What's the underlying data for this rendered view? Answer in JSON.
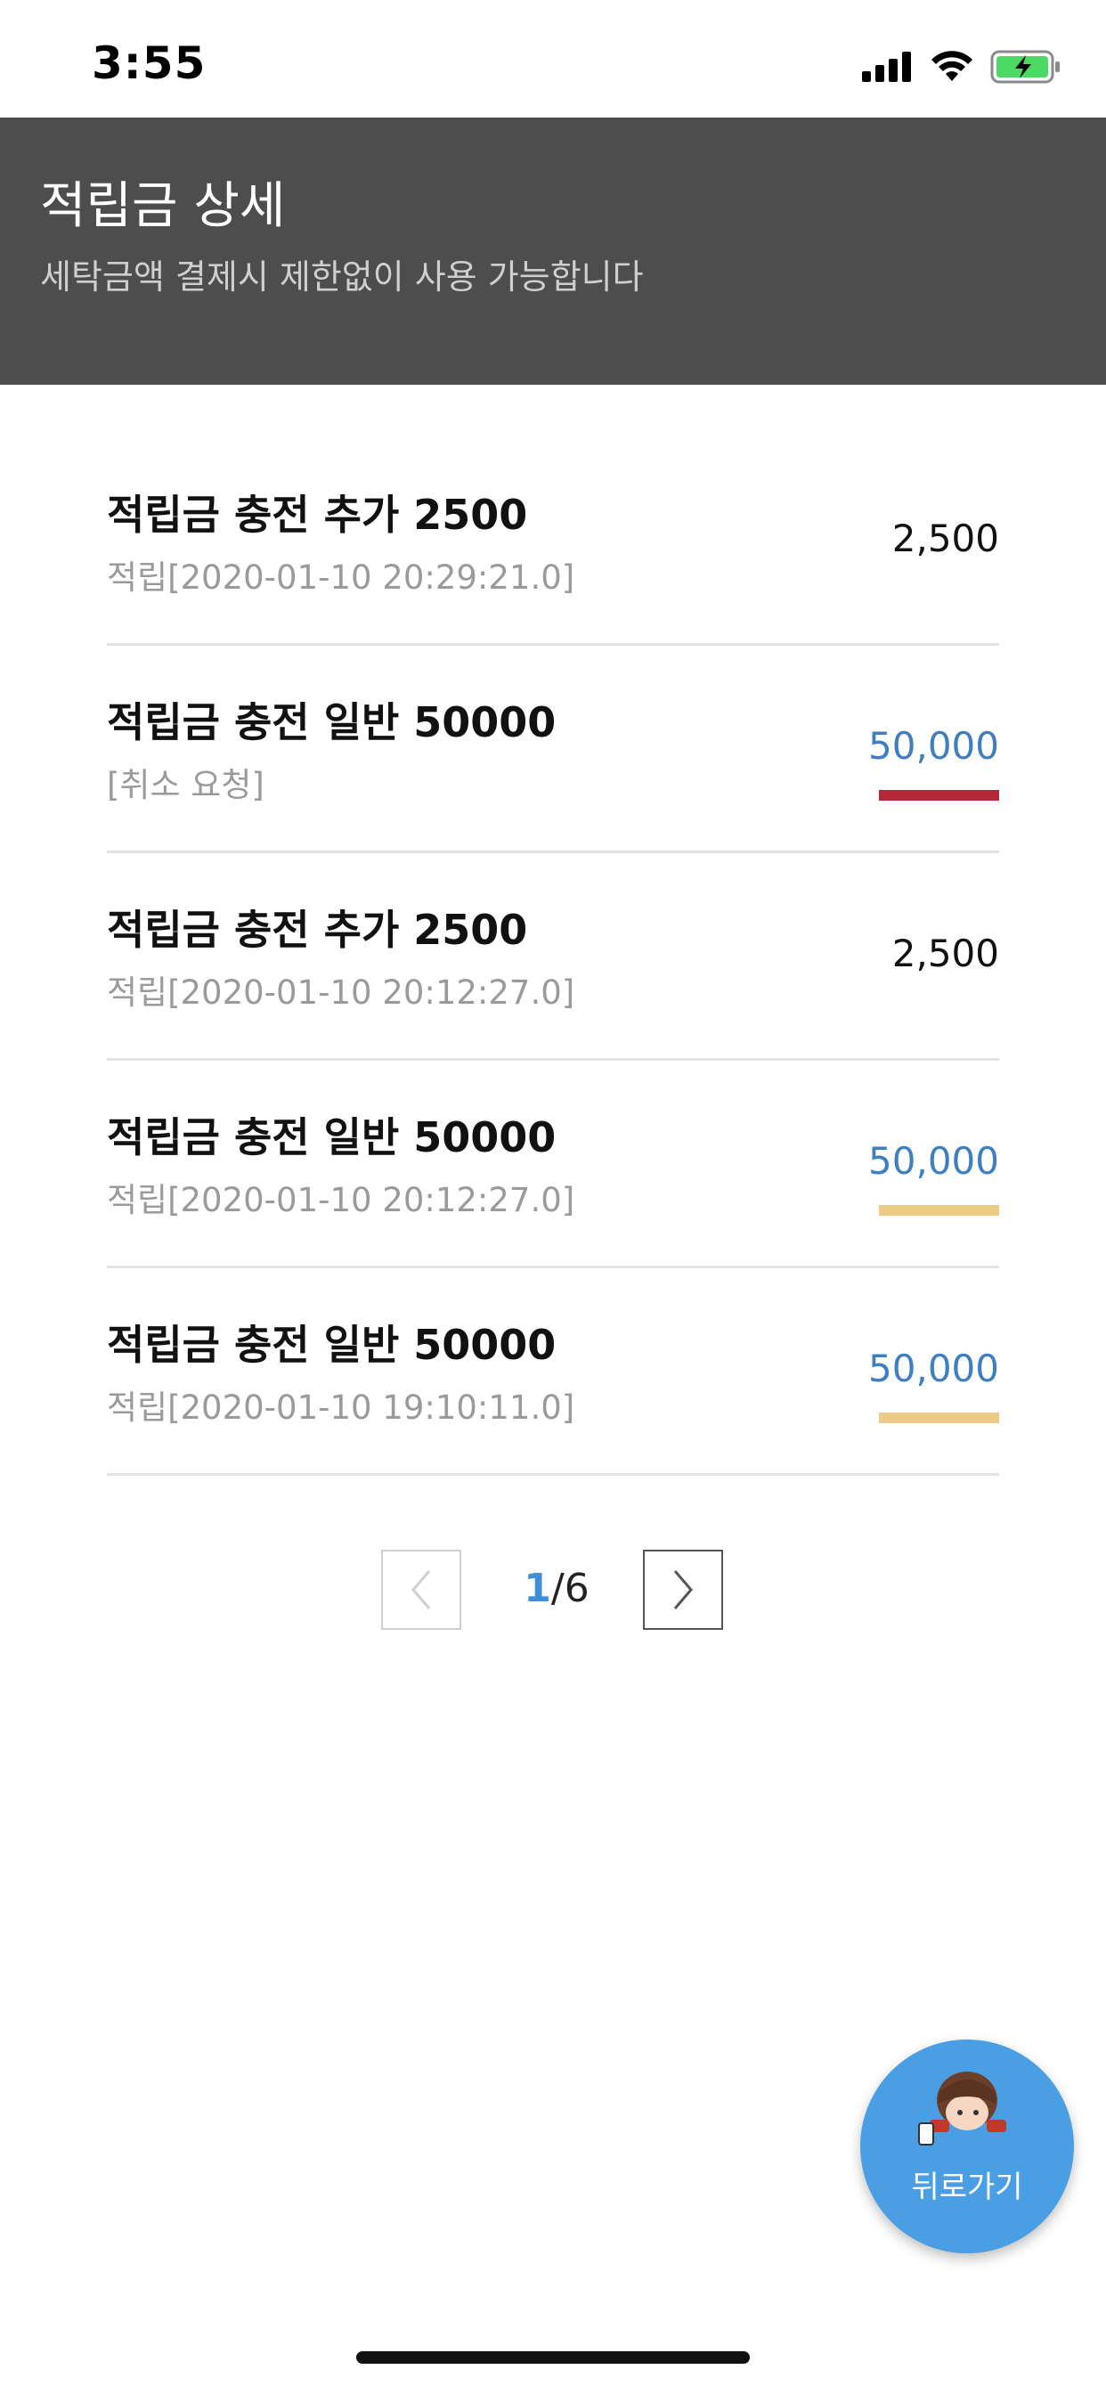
{
  "status_bar": {
    "time": "3:55",
    "icons": [
      "signal-icon",
      "wifi-icon",
      "battery-charging-icon"
    ]
  },
  "header": {
    "title": "적립금 상세",
    "subtitle": "세탁금액 결제시 제한없이 사용 가능합니다"
  },
  "items": [
    {
      "title": "적립금 충전 추가 2500",
      "sub": "적립[2020-01-10 20:29:21.0]",
      "amount": "2,500",
      "amount_color": "#111111",
      "bar_color": ""
    },
    {
      "title": "적립금 충전 일반 50000",
      "sub": "[취소 요청]",
      "amount": "50,000",
      "amount_color": "#3f7fbf",
      "bar_color": "#b5283a"
    },
    {
      "title": "적립금 충전 추가 2500",
      "sub": "적립[2020-01-10 20:12:27.0]",
      "amount": "2,500",
      "amount_color": "#111111",
      "bar_color": ""
    },
    {
      "title": "적립금 충전 일반 50000",
      "sub": "적립[2020-01-10 20:12:27.0]",
      "amount": "50,000",
      "amount_color": "#3f7fbf",
      "bar_color": "#eccb86"
    },
    {
      "title": "적립금 충전 일반 50000",
      "sub": "적립[2020-01-10 19:10:11.0]",
      "amount": "50,000",
      "amount_color": "#3f7fbf",
      "bar_color": "#eccb86"
    }
  ],
  "pagination": {
    "current": "1",
    "separator": "/",
    "total": "6"
  },
  "fab": {
    "label": "뒤로가기",
    "color": "#4a9ee3"
  }
}
